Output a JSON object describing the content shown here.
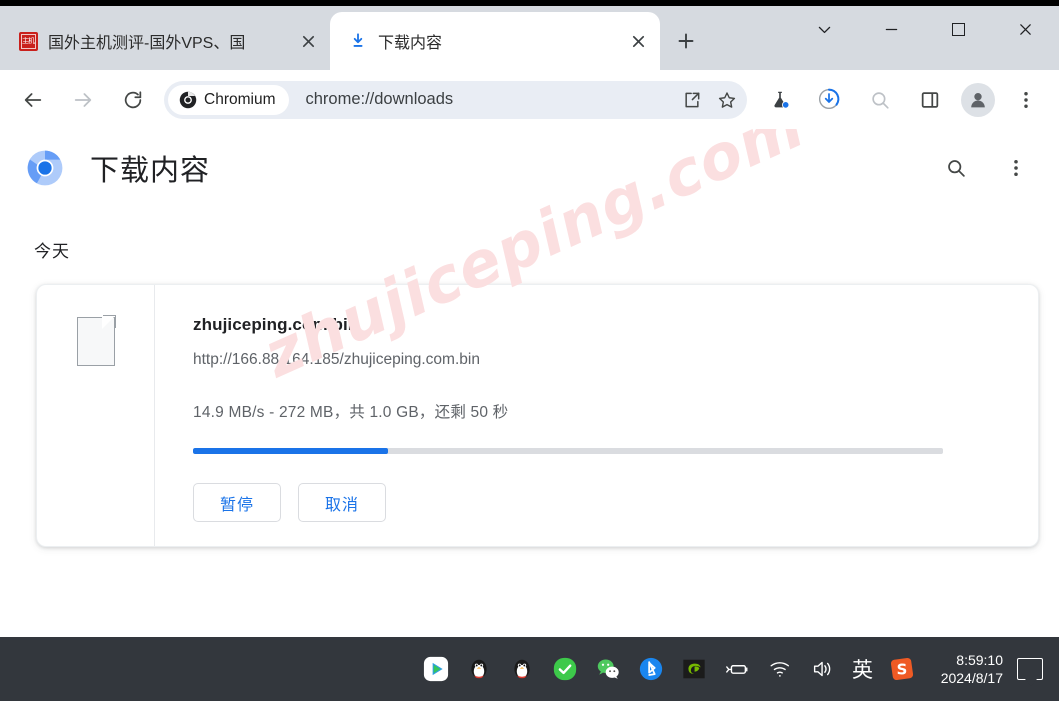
{
  "window": {
    "controls": {
      "tab_search": "tab-search",
      "minimize": "minimize",
      "maximize": "maximize",
      "close": "close"
    }
  },
  "tabs": [
    {
      "title": "国外主机测评-国外VPS、国",
      "favicon": "red-site-favicon",
      "active": false,
      "close_label": "×"
    },
    {
      "title": "下载内容",
      "favicon": "download-icon",
      "active": true,
      "close_label": "×"
    }
  ],
  "new_tab_label": "+",
  "toolbar": {
    "back": "back-arrow",
    "forward": "forward-arrow",
    "reload": "reload",
    "chip_label": "Chromium",
    "url": "chrome://downloads",
    "share": "share-icon",
    "bookmark": "star-icon",
    "experiments": "flask-icon",
    "downloads": "downloads-icon",
    "search": "search-icon",
    "side_panel": "side-panel-icon",
    "profile": "avatar-icon",
    "menu": "three-dot-menu"
  },
  "page": {
    "logo": "chromium-logo",
    "title": "下载内容",
    "search_label": "search-icon",
    "menu_label": "three-dot-menu",
    "date_heading": "今天"
  },
  "download": {
    "file_icon": "generic-file-icon",
    "filename": "zhujiceping.com.bin",
    "url": "http://166.88.164.185/zhujiceping.com.bin",
    "status": "14.9 MB/s - 272 MB，共 1.0 GB，还剩 50 秒",
    "progress_percent": 26,
    "progress_color": "#1a73e8",
    "pause_label": "暂停",
    "cancel_label": "取消"
  },
  "watermark": "zhujiceping.com",
  "taskbar": {
    "tray_icons": [
      "media-player-icon",
      "qq-penguin-icon",
      "qq-penguin-icon-2",
      "green-check-icon",
      "wechat-icon",
      "bluetooth-icon",
      "nvidia-icon",
      "battery-icon",
      "wifi-icon",
      "volume-icon"
    ],
    "ime_label": "英",
    "sogou_label": "S",
    "time": "8:59:10",
    "date": "2024/8/17",
    "notification": "notification-icon"
  }
}
